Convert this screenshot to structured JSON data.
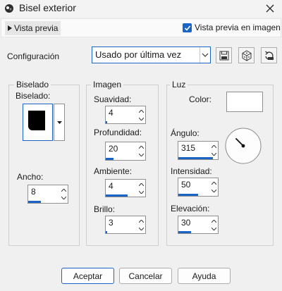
{
  "window": {
    "title": "Bisel exterior",
    "close_icon": "close-icon",
    "app_icon": "paint-shop-icon"
  },
  "preview": {
    "toggle_label": "Vista previa",
    "checkbox_label": "Vista previa en imagen",
    "checked": true
  },
  "config": {
    "label": "Configuración",
    "preset_value": "Usado por última vez"
  },
  "toolbar": {
    "save_icon": "save-icon",
    "random_icon": "dice-icon",
    "reset_icon": "reset-icon"
  },
  "bevel": {
    "group_title": "Biselado",
    "shape_label": "Biselado:",
    "width_label": "Ancho:",
    "width_value": "8",
    "width_fraction": 0.33
  },
  "image": {
    "group_title": "Imagen",
    "smoothness_label": "Suavidad:",
    "smoothness_value": "4",
    "smoothness_fraction": 0.04,
    "depth_label": "Profundidad:",
    "depth_value": "20",
    "depth_fraction": 0.2,
    "ambient_label": "Ambiente:",
    "ambient_value": "4",
    "ambient_fraction": 0.55,
    "gloss_label": "Brillo:",
    "gloss_value": "3",
    "gloss_fraction": 0.03
  },
  "light": {
    "group_title": "Luz",
    "color_label": "Color:",
    "color_value": "#ffffff",
    "angle_label": "Ángulo:",
    "angle_value": "315",
    "angle_fraction": 0.88,
    "intensity_label": "Intensidad:",
    "intensity_value": "50",
    "intensity_fraction": 0.5,
    "elevation_label": "Elevación:",
    "elevation_value": "30",
    "elevation_fraction": 0.33
  },
  "buttons": {
    "ok": "Aceptar",
    "cancel": "Cancelar",
    "help": "Ayuda"
  },
  "accent": "#1964c4"
}
